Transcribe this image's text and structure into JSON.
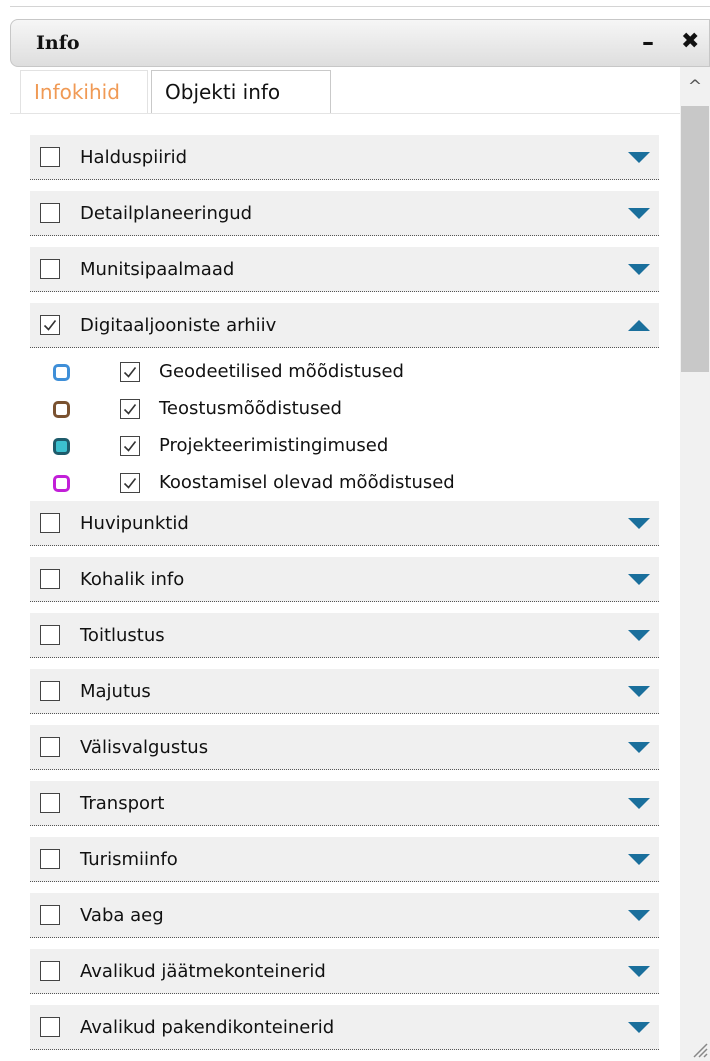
{
  "panel": {
    "title": "Info",
    "minimize_symbol": "–",
    "close_symbol": "✖"
  },
  "tabs": [
    {
      "label": "Infokihid",
      "active": true
    },
    {
      "label": "Objekti info",
      "active": false
    }
  ],
  "layers": [
    {
      "label": "Halduspiirid",
      "checked": false,
      "expanded": false
    },
    {
      "label": "Detailplaneeringud",
      "checked": false,
      "expanded": false
    },
    {
      "label": "Munitsipaalmaad",
      "checked": false,
      "expanded": false
    },
    {
      "label": "Digitaaljooniste arhiiv",
      "checked": true,
      "expanded": true
    },
    {
      "label": "Huvipunktid",
      "checked": false,
      "expanded": false
    },
    {
      "label": "Kohalik info",
      "checked": false,
      "expanded": false
    },
    {
      "label": "Toitlustus",
      "checked": false,
      "expanded": false
    },
    {
      "label": "Majutus",
      "checked": false,
      "expanded": false
    },
    {
      "label": "Välisvalgustus",
      "checked": false,
      "expanded": false
    },
    {
      "label": "Transport",
      "checked": false,
      "expanded": false
    },
    {
      "label": "Turismiinfo",
      "checked": false,
      "expanded": false
    },
    {
      "label": "Vaba aeg",
      "checked": false,
      "expanded": false
    },
    {
      "label": "Avalikud jäätmekonteinerid",
      "checked": false,
      "expanded": false
    },
    {
      "label": "Avalikud pakendikonteinerid",
      "checked": false,
      "expanded": false
    }
  ],
  "sublayers": [
    {
      "label": "Geodeetilised mõõdistused",
      "checked": true,
      "border_color": "#3f8fd8",
      "fill_color": "#ffffff"
    },
    {
      "label": "Teostusmõõdistused",
      "checked": true,
      "border_color": "#7a5230",
      "fill_color": "#ffffff"
    },
    {
      "label": "Projekteerimistingimused",
      "checked": true,
      "border_color": "#1e5b6b",
      "fill_color": "#3cc0cf"
    },
    {
      "label": "Koostamisel olevad mõõdistused",
      "checked": true,
      "border_color": "#c21fd8",
      "fill_color": "#ffffff"
    }
  ],
  "icons": {
    "scroll_up": "^"
  }
}
